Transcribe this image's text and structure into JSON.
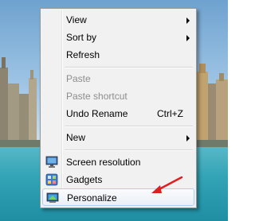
{
  "context_menu": {
    "items": [
      {
        "label": "View",
        "submenu": true
      },
      {
        "label": "Sort by",
        "submenu": true
      },
      {
        "label": "Refresh"
      },
      {
        "label": "Paste",
        "disabled": true
      },
      {
        "label": "Paste shortcut",
        "disabled": true
      },
      {
        "label": "Undo Rename",
        "shortcut": "Ctrl+Z"
      },
      {
        "label": "New",
        "submenu": true
      },
      {
        "label": "Screen resolution",
        "icon": "display-icon"
      },
      {
        "label": "Gadgets",
        "icon": "gadgets-icon"
      },
      {
        "label": "Personalize",
        "icon": "personalize-icon",
        "highlighted": true
      }
    ]
  },
  "annotation": {
    "arrow_color": "#e02020"
  },
  "colors": {
    "menu_bg": "#f1f1f1",
    "highlight_border": "#aecff7",
    "disabled_text": "#8d8d8d"
  }
}
